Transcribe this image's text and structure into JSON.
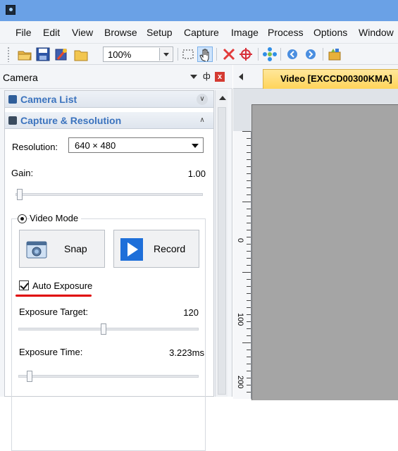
{
  "menu": [
    "File",
    "Edit",
    "View",
    "Browse",
    "Setup",
    "Capture",
    "Image",
    "Process",
    "Options",
    "Window"
  ],
  "toolbar": {
    "zoom_value": "100%",
    "icons": [
      "open-folder-icon",
      "save-icon",
      "clear-icon",
      "folder-icon",
      "select-region-icon",
      "hand-pan-icon",
      "delete-cross-icon",
      "crosshair-icon",
      "move-icon",
      "back-icon",
      "forward-icon",
      "plugin-icon"
    ]
  },
  "camera_panel": {
    "title": "Camera",
    "close_label": "x",
    "camera_list": {
      "title": "Camera List"
    },
    "capture_resolution": {
      "title": "Capture & Resolution",
      "resolution_label": "Resolution:",
      "resolution_value": "640 × 480",
      "gain_label": "Gain:",
      "gain_value": "1.00",
      "gain_level": 0.0,
      "video_mode_label": "Video Mode",
      "video_mode_selected": true,
      "snap_label": "Snap",
      "record_label": "Record",
      "auto_exposure_label": "Auto Exposure",
      "auto_exposure_checked": true,
      "exposure_target_label": "Exposure Target:",
      "exposure_target_value": "120",
      "exposure_time_label": "Exposure Time:",
      "exposure_time_value": "3.223ms"
    }
  },
  "document": {
    "tab_label": "Video [EXCCD00300KMA]",
    "ruler_labels": [
      "0",
      "100",
      "200"
    ]
  },
  "colors": {
    "titlebar": "#6aa1e6",
    "section_title": "#3b73be",
    "tab_active": "#ffd45a",
    "annotation_underline": "#e00000"
  }
}
